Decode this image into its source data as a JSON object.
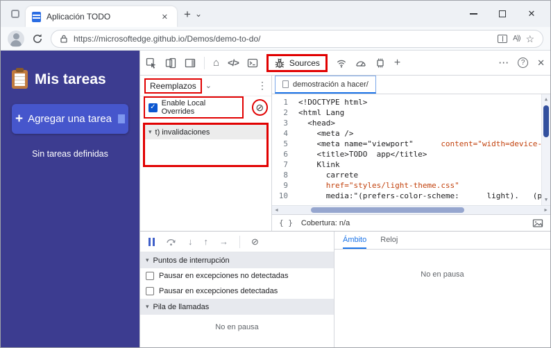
{
  "colors": {
    "highlight_red": "#e10000",
    "app_background": "#3c3c90",
    "app_button": "#4656cc",
    "devtools_accent": "#1a73e8",
    "code_string_orange": "#c2410c",
    "scrollbar_thumb": "#33509e"
  },
  "icons": {
    "close_tab": "✕",
    "new_tab": "+",
    "tab_list_chevron": "⌄",
    "window_close": "✕",
    "read_aloud": "A))",
    "star": "☆",
    "home": "⌂",
    "elements": "</>",
    "plus_tool": "+",
    "more_horizontal": "⋯",
    "help": "?",
    "close_devtools": "✕",
    "dropdown_chevron": "⌄",
    "more_vertical": "⋮",
    "check": "✓",
    "block": "⊘",
    "triangle_down": "▾",
    "braces": "{ }",
    "step_into": "↓",
    "step_out": "↑",
    "step_next": "→",
    "scroll_up": "▲",
    "scroll_down": "▼",
    "scroll_left": "◄",
    "scroll_right": "►"
  },
  "titlebar": {
    "tab_title": "Aplicación TODO"
  },
  "navbar": {
    "url": "https://microsoftedge.github.io/Demos/demo-to-do/"
  },
  "todo_app": {
    "title": "Mis tareas",
    "add_plus": "+",
    "add_label": "Agregar una tarea",
    "empty_message": "Sin tareas definidas"
  },
  "devtools": {
    "toolbar": {
      "sources_label": "Sources"
    },
    "overrides": {
      "dropdown_label": "Reemplazos",
      "enable_label": "Enable Local Overrides",
      "folder_label": "t) invalidaciones"
    },
    "editor": {
      "tab_label": "demostración a hacer/",
      "coverage_status": "Cobertura: n/a",
      "lines": [
        {
          "n": "1",
          "a": "<!DOCTYPE html>",
          "b": ""
        },
        {
          "n": "2",
          "a": "<html Lang",
          "b": ""
        },
        {
          "n": "3",
          "a": "  <head>",
          "b": ""
        },
        {
          "n": "4",
          "a": "    <meta />",
          "b": ""
        },
        {
          "n": "5",
          "a": "    <meta name=\"viewport\"      ",
          "b": "content=\"width=device-"
        },
        {
          "n": "6",
          "a": "    <title>TODO  app</title>",
          "b": ""
        },
        {
          "n": "7",
          "a": "    Klink",
          "b": ""
        },
        {
          "n": "8",
          "a": "      carrete",
          "b": ""
        },
        {
          "n": "9",
          "a": "      ",
          "b": "href=\"styles/light-theme.css\""
        },
        {
          "n": "10",
          "a": "      media:\"(prefers-color-scheme:      light).   (pre",
          "b": ""
        }
      ]
    },
    "debugger": {
      "breakpoints_title": "Puntos de interrupción",
      "pause_uncaught_label": "Pausar en excepciones no detectadas",
      "pause_caught_label": "Pausar en excepciones detectadas",
      "callstack_title": "Pila de llamadas",
      "not_paused": "No en pausa",
      "scope_tab": "Ámbito",
      "watch_tab": "Reloj",
      "scope_not_paused": "No en pausa"
    }
  }
}
